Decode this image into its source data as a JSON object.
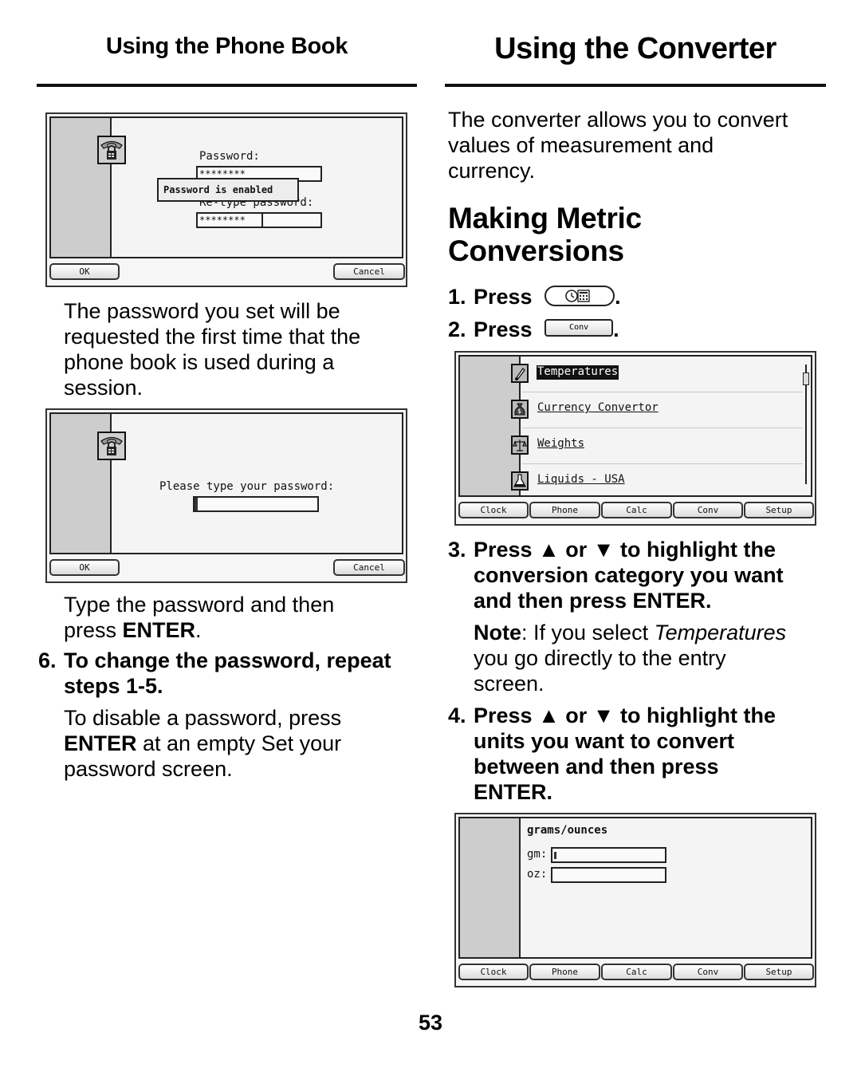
{
  "left": {
    "section_title": "Using the Phone Book",
    "screen1": {
      "password_label": "Password:",
      "password_value": "********",
      "popup_text": "Password is enabled",
      "retype_label": "Re-type password:",
      "retype_value": "********",
      "ok_label": "OK",
      "cancel_label": "Cancel",
      "icon": "phone-lock-icon"
    },
    "paragraph1": [
      "The password you set will be",
      "requested the first time that the",
      "phone book is used during a",
      "session."
    ],
    "screen2": {
      "prompt": "Please type your password:",
      "password_value": "",
      "ok_label": "OK",
      "cancel_label": "Cancel",
      "icon": "phone-lock-icon"
    },
    "paragraph2_line1": "Type the password and then",
    "paragraph2_line2_pre": "press ",
    "paragraph2_line2_bold": "ENTER",
    "paragraph2_line2_post": ".",
    "step6": {
      "number": "6.",
      "line1": "To change the password, repeat",
      "line2": "steps 1-5."
    },
    "paragraph3_line1": "To disable a password, press",
    "paragraph3_line2_bold": "ENTER",
    "paragraph3_line2_post": " at an empty Set your",
    "paragraph3_line3": "password screen."
  },
  "right": {
    "section_title": "Using the Converter",
    "intro": [
      "The converter allows you to convert",
      "values of measurement and",
      "currency."
    ],
    "subheading": [
      "Making Metric",
      "Conversions"
    ],
    "step1": {
      "number": "1.",
      "text": "Press",
      "button_icon": "clock-calculator-icon",
      "suffix": "."
    },
    "step2": {
      "number": "2.",
      "text": "Press",
      "button_label": "Conv",
      "suffix": "."
    },
    "screen3": {
      "items": [
        {
          "label": "Temperatures",
          "icon": "thermometer-icon",
          "selected": true
        },
        {
          "label": "Currency Convertor",
          "icon": "money-bag-icon",
          "selected": false
        },
        {
          "label": "Weights",
          "icon": "scale-icon",
          "selected": false
        },
        {
          "label": "Liquids - USA",
          "icon": "flask-icon",
          "selected": false
        }
      ],
      "tabs": [
        "Clock",
        "Phone",
        "Calc",
        "Conv",
        "Setup"
      ]
    },
    "step3": {
      "number": "3.",
      "lines": [
        "Press ▲ or ▼ to highlight the",
        "conversion category you want",
        "and then press ENTER."
      ]
    },
    "note": {
      "label": "Note",
      "line1_pre": ": If you select ",
      "line1_italic": "Temperatures",
      "line2": "you go directly to the entry",
      "line3": "screen."
    },
    "step4": {
      "number": "4.",
      "lines": [
        "Press ▲ or ▼ to highlight the",
        "units you want to convert",
        "between and then press",
        "ENTER."
      ]
    },
    "screen4": {
      "title": "grams/ounces",
      "field1_label": "gm:",
      "field1_value": "",
      "field2_label": "oz:",
      "field2_value": "",
      "tabs": [
        "Clock",
        "Phone",
        "Calc",
        "Conv",
        "Setup"
      ]
    }
  },
  "page_number": "53"
}
